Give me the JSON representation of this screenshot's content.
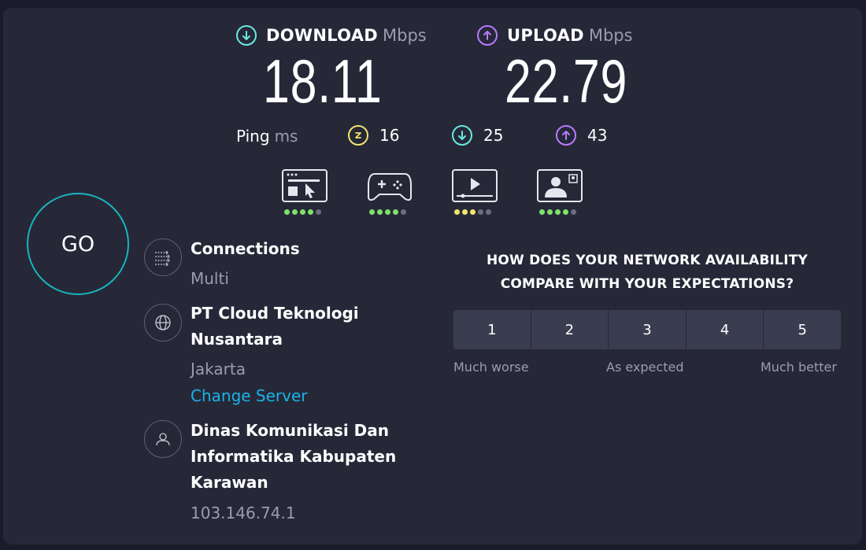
{
  "download": {
    "label": "DOWNLOAD",
    "unit": "Mbps",
    "value": "18.11",
    "color": "#6ae8e0"
  },
  "upload": {
    "label": "UPLOAD",
    "unit": "Mbps",
    "value": "22.79",
    "color": "#b77bff"
  },
  "ping": {
    "label": "Ping",
    "unit": "ms",
    "idle": {
      "value": "16",
      "icon": "lightning-icon",
      "color": "#f1e46b"
    },
    "download": {
      "value": "25",
      "icon": "arrow-down-icon",
      "color": "#6ae8e0"
    },
    "upload": {
      "value": "43",
      "icon": "arrow-up-icon",
      "color": "#b77bff"
    }
  },
  "use_cases": [
    {
      "icon": "web-browsing-icon",
      "rating": 4,
      "max": 5,
      "color": "#7ee26a"
    },
    {
      "icon": "gaming-icon",
      "rating": 4,
      "max": 5,
      "color": "#7ee26a"
    },
    {
      "icon": "video-streaming-icon",
      "rating": 3,
      "max": 5,
      "color": "#f1e46b"
    },
    {
      "icon": "video-call-icon",
      "rating": 4,
      "max": 5,
      "color": "#7ee26a"
    }
  ],
  "go_label": "GO",
  "connections": {
    "title": "Connections",
    "value": "Multi"
  },
  "server": {
    "name_line1": "PT Cloud Teknologi",
    "name_line2": "Nusantara",
    "location": "Jakarta",
    "change_label": "Change Server"
  },
  "provider": {
    "line1": "Dinas Komunikasi Dan",
    "line2": "Informatika Kabupaten",
    "line3": "Karawan",
    "ip": "103.146.74.1"
  },
  "survey": {
    "question_line1": "HOW DOES YOUR NETWORK AVAILABILITY",
    "question_line2": "COMPARE WITH YOUR EXPECTATIONS?",
    "options": [
      "1",
      "2",
      "3",
      "4",
      "5"
    ],
    "caption_low": "Much worse",
    "caption_mid": "As expected",
    "caption_high": "Much better"
  }
}
